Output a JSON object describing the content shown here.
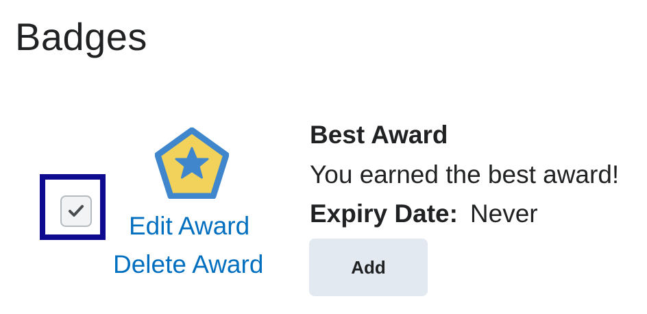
{
  "page": {
    "title": "Badges"
  },
  "award": {
    "selected": true,
    "name": "Best Award",
    "description": "You earned the best award!",
    "expiry_label": "Expiry Date:",
    "expiry_value": "Never",
    "edit_label": "Edit Award",
    "delete_label": "Delete Award",
    "add_label": "Add",
    "badge_icon": "pentagon-star-badge-icon"
  },
  "colors": {
    "link": "#006fbf",
    "focus_ring": "#0d0a8f",
    "badge_outline": "#3f86cc",
    "badge_fill": "#f2d25a",
    "badge_star": "#3f86cc",
    "button_bg": "#e3e9f1"
  }
}
